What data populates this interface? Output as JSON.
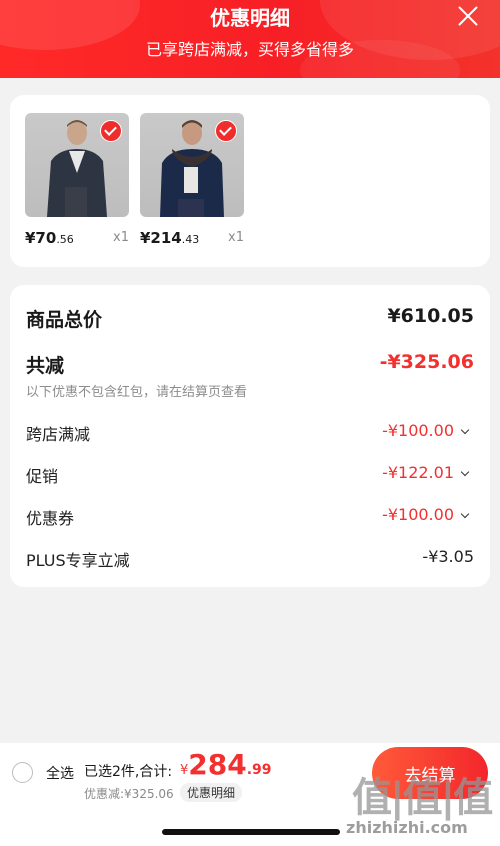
{
  "header": {
    "title": "优惠明细",
    "subtitle": "已享跨店满减，买得多省得多"
  },
  "products": [
    {
      "price_int": "¥70",
      "price_dec": ".56",
      "qty": "x1",
      "image": "man in dark leather jacket"
    },
    {
      "price_int": "¥214",
      "price_dec": ".43",
      "qty": "x1",
      "image": "man in navy jacket with fur collar"
    }
  ],
  "summary": {
    "total_label": "商品总价",
    "total_value": "¥610.05",
    "reduce_label": "共减",
    "reduce_value": "-¥325.06",
    "note": "以下优惠不包含红包，请在结算页查看",
    "items": [
      {
        "label": "跨店满减",
        "value": "-¥100.00"
      },
      {
        "label": "促销",
        "value": "-¥122.01"
      },
      {
        "label": "优惠券",
        "value": "-¥100.00"
      },
      {
        "label": "PLUS专享立减",
        "value": "-¥3.05"
      }
    ]
  },
  "bottom": {
    "select_all": "全选",
    "selected": "已选2件,合计:",
    "total_currency": "¥",
    "total_int": "284",
    "total_dec": ".99",
    "discount": "优惠减:¥325.06",
    "detail": "优惠明细",
    "checkout": "去结算"
  },
  "watermark": {
    "logo": "值|值|值",
    "url": "zhizhizhi.com"
  },
  "colors": {
    "accent": "#f23030",
    "header": "#f71f25"
  }
}
